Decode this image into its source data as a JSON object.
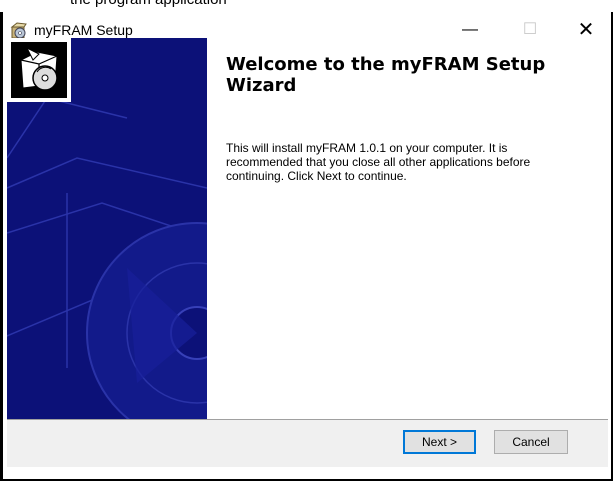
{
  "top_strip": {
    "text": "the program application"
  },
  "window": {
    "title": "myFRAM Setup",
    "controls": {
      "minimize": "—",
      "maximize": "☐",
      "close": "✕"
    }
  },
  "content": {
    "heading": "Welcome to the myFRAM Setup Wizard",
    "body": "This will install myFRAM 1.0.1 on your computer. It is recommended that you close all other applications before continuing. Click Next to continue."
  },
  "buttons": {
    "next": "Next >",
    "cancel": "Cancel"
  },
  "colors": {
    "banner": "#0c1178",
    "focus": "#0078d7"
  },
  "icons": {
    "app": "installer-box-icon",
    "badge": "installer-disc-icon"
  }
}
